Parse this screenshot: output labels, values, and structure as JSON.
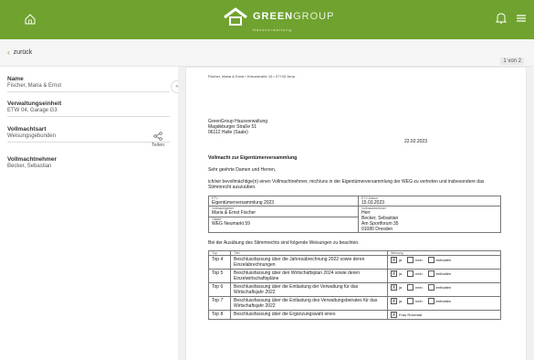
{
  "header": {
    "logo_main": "GREEN",
    "logo_light": "GROUP",
    "logo_sub": "Hausverwaltung",
    "home_icon": "home-icon",
    "bell_icon": "bell-icon",
    "menu_icon": "menu-icon",
    "brand_color": "#6fa22e"
  },
  "nav": {
    "back_label": "zurück",
    "pager": "1 von 2"
  },
  "sidebar": {
    "fields": [
      {
        "label": "Name",
        "value": "Fischer, Maria & Ernst"
      },
      {
        "label": "Verwaltungseinheit",
        "value": "ETW 04, Garage G3"
      },
      {
        "label": "Vollmachtsart",
        "value": "Weisungsgebunden"
      },
      {
        "label": "Vollmachtnehmer",
        "value": "Becker, Sebastian"
      }
    ],
    "share_label": "Teilen"
  },
  "doc": {
    "sender": "Fischer, Maria & Ernst • Kreuzstraße 15 • 07743 Jena",
    "addr1": "GreenGroup Hausverwaltung",
    "addr2": "Magdeburger Straße 51",
    "addr3": "06112 Halle (Saale)",
    "date": "22.02.2023",
    "title": "Vollmacht zur Eigentümerversammlung",
    "greeting": "Sehr geehrte Damen und Herren,",
    "intro": "ich/wir bevollmächtige(n) einen Vollmachtnehmer, mich/uns in der Eigentümerversammlung der WEG zu vertreten und insbesondere das Stimmrecht auszuüben.",
    "info": {
      "etv_cap": "ETV",
      "etv": "Eigentümerversammlung 2023",
      "etv_date_cap": "ETV-Datum",
      "etv_date": "15.03.2023",
      "giver_cap": "Vollmachtgeber",
      "giver": "Maria & Ernst Fischer",
      "taker_cap": "Vollmachtnehmer",
      "taker1": "Herr",
      "taker2": "Becker, Sebastian",
      "taker3": "Am Sportforum 35",
      "taker4": "01080  Dresden",
      "obj_cap": "Objekt",
      "obj": "WEG Neumarkt 59"
    },
    "instr": "Bei der Ausübung des Stimmrechts sind folgende Weisungen zu beachten.",
    "vote_head": {
      "top": "Top",
      "title": "Titel",
      "weisung": "Weisung"
    },
    "opts": {
      "ja": "ja",
      "nein": "nein",
      "enth": "enthalten"
    },
    "votes": [
      {
        "top": "Top 4",
        "title": "Beschlussfassung über die Jahresabrechnung 2022 sowie deren Einzelabrechnungen"
      },
      {
        "top": "Top 5",
        "title": "Beschlussfassung über den Wirtschaftsplan 2024 sowie deren Einzelwirtschaftspläne"
      },
      {
        "top": "Top 6",
        "title": "Beschlussfassung über die Entlastung der Verwaltung für das Wirtschaftsjahr 2022"
      },
      {
        "top": "Top 7",
        "title": "Beschlussfassung über die Entlastung des Verwaltungsbeirates für das Wirtschaftsjahr 2022"
      },
      {
        "top": "Top 8",
        "title": "Beschlussfassung über die Ergänzungswahl eines",
        "candidate": "Frau Rosental"
      }
    ]
  }
}
